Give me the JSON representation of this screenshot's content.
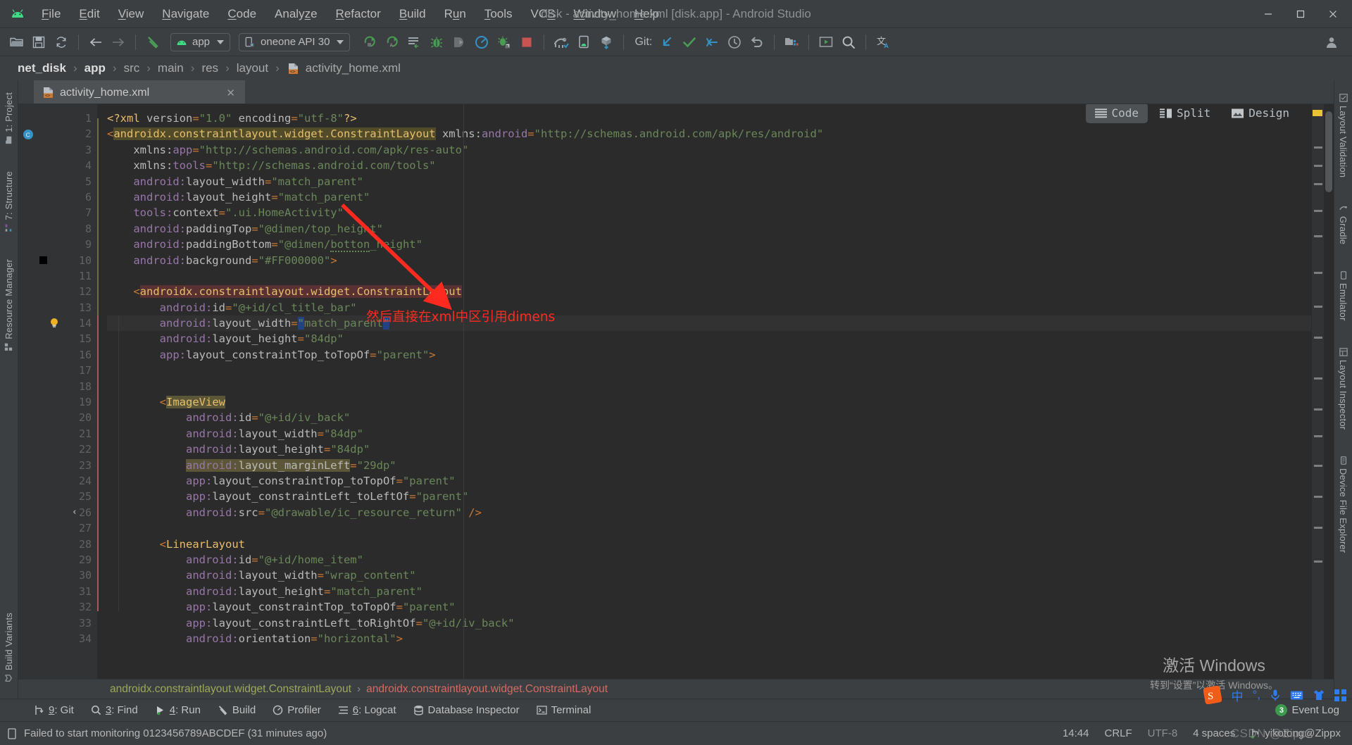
{
  "window": {
    "title": "disk - activity_home.xml [disk.app] - Android Studio",
    "minimize": "–",
    "maximize": "❐",
    "close": "✕"
  },
  "menu": {
    "items": [
      {
        "label": "File",
        "mnemonic": "F"
      },
      {
        "label": "Edit",
        "mnemonic": "E"
      },
      {
        "label": "View",
        "mnemonic": "V"
      },
      {
        "label": "Navigate",
        "mnemonic": "N"
      },
      {
        "label": "Code",
        "mnemonic": "C"
      },
      {
        "label": "Analyze",
        "mnemonic": "z"
      },
      {
        "label": "Refactor",
        "mnemonic": "R"
      },
      {
        "label": "Build",
        "mnemonic": "B"
      },
      {
        "label": "Run",
        "mnemonic": "u"
      },
      {
        "label": "Tools",
        "mnemonic": "T"
      },
      {
        "label": "VCS",
        "mnemonic": "S"
      },
      {
        "label": "Window",
        "mnemonic": "W"
      },
      {
        "label": "Help",
        "mnemonic": "H"
      }
    ]
  },
  "toolbar": {
    "open_icon": "folder-open-icon",
    "save_icon": "save-icon",
    "sync_icon": "sync-icon",
    "back_icon": "back-arrow-icon",
    "forward_icon": "forward-arrow-icon",
    "build_icon": "hammer-icon",
    "module_selector": "app",
    "device_selector": "oneone API 30",
    "run_icon": "run-icon",
    "debug_icon": "debug-icon",
    "apply_changes_icon": "apply-changes-icon",
    "stop_icon": "stop-icon",
    "git_label": "Git:",
    "update_icon": "update-project-icon",
    "commit_icon": "commit-checkmark-icon",
    "push_icon": "push-icon",
    "history_icon": "history-clock-icon",
    "undo_icon": "undo-icon",
    "sdk_manager_icon": "sdk-manager-icon",
    "avd_manager_icon": "avd-manager-icon",
    "search_icon": "search-everywhere-icon",
    "translate_icon": "translate-icon",
    "account_icon": "account-icon"
  },
  "breadcrumb": {
    "items": [
      "net_disk",
      "app",
      "src",
      "main",
      "res",
      "layout",
      "activity_home.xml"
    ],
    "separator": "›",
    "file_icon": "xml-file-icon"
  },
  "editor": {
    "tab": {
      "label": "activity_home.xml",
      "icon": "xml-file-icon",
      "close": "✕"
    },
    "view_modes": [
      {
        "label": "Code",
        "icon": "code-lines-icon",
        "active": true
      },
      {
        "label": "Split",
        "icon": "split-view-icon",
        "active": false
      },
      {
        "label": "Design",
        "icon": "design-preview-icon",
        "active": false
      }
    ],
    "code_breadcrumb": {
      "parent": "androidx.constraintlayout.widget.ConstraintLayout",
      "separator": "›",
      "current": "androidx.constraintlayout.widget.ConstraintLayout"
    },
    "lines": [
      {
        "n": 1,
        "indent": 0,
        "text": "<?xml version=\"1.0\" encoding=\"utf-8\"?>"
      },
      {
        "n": 2,
        "indent": 0,
        "text": "<androidx.constraintlayout.widget.ConstraintLayout xmlns:android=\"http://schemas.android.com/apk/res/android\""
      },
      {
        "n": 3,
        "indent": 1,
        "text": "xmlns:app=\"http://schemas.android.com/apk/res-auto\""
      },
      {
        "n": 4,
        "indent": 1,
        "text": "xmlns:tools=\"http://schemas.android.com/tools\""
      },
      {
        "n": 5,
        "indent": 1,
        "text": "android:layout_width=\"match_parent\""
      },
      {
        "n": 6,
        "indent": 1,
        "text": "android:layout_height=\"match_parent\""
      },
      {
        "n": 7,
        "indent": 1,
        "text": "tools:context=\".ui.HomeActivity\""
      },
      {
        "n": 8,
        "indent": 1,
        "text": "android:paddingTop=\"@dimen/top_height\""
      },
      {
        "n": 9,
        "indent": 1,
        "text": "android:paddingBottom=\"@dimen/botton_height\""
      },
      {
        "n": 10,
        "indent": 1,
        "text": "android:background=\"#FF000000\">"
      },
      {
        "n": 11,
        "indent": 0,
        "text": ""
      },
      {
        "n": 12,
        "indent": 1,
        "text": "<androidx.constraintlayout.widget.ConstraintLayout"
      },
      {
        "n": 13,
        "indent": 2,
        "text": "android:id=\"@+id/cl_title_bar\""
      },
      {
        "n": 14,
        "indent": 2,
        "text": "android:layout_width=\"match_parent\""
      },
      {
        "n": 15,
        "indent": 2,
        "text": "android:layout_height=\"84dp\""
      },
      {
        "n": 16,
        "indent": 2,
        "text": "app:layout_constraintTop_toTopOf=\"parent\">"
      },
      {
        "n": 17,
        "indent": 0,
        "text": ""
      },
      {
        "n": 18,
        "indent": 0,
        "text": ""
      },
      {
        "n": 19,
        "indent": 2,
        "text": "<ImageView"
      },
      {
        "n": 20,
        "indent": 3,
        "text": "android:id=\"@+id/iv_back\""
      },
      {
        "n": 21,
        "indent": 3,
        "text": "android:layout_width=\"84dp\""
      },
      {
        "n": 22,
        "indent": 3,
        "text": "android:layout_height=\"84dp\""
      },
      {
        "n": 23,
        "indent": 3,
        "text": "android:layout_marginLeft=\"29dp\""
      },
      {
        "n": 24,
        "indent": 3,
        "text": "app:layout_constraintTop_toTopOf=\"parent\""
      },
      {
        "n": 25,
        "indent": 3,
        "text": "app:layout_constraintLeft_toLeftOf=\"parent\""
      },
      {
        "n": 26,
        "indent": 3,
        "text": "android:src=\"@drawable/ic_resource_return\" />"
      },
      {
        "n": 27,
        "indent": 0,
        "text": ""
      },
      {
        "n": 28,
        "indent": 2,
        "text": "<LinearLayout"
      },
      {
        "n": 29,
        "indent": 3,
        "text": "android:id=\"@+id/home_item\""
      },
      {
        "n": 30,
        "indent": 3,
        "text": "android:layout_width=\"wrap_content\""
      },
      {
        "n": 31,
        "indent": 3,
        "text": "android:layout_height=\"match_parent\""
      },
      {
        "n": 32,
        "indent": 3,
        "text": "app:layout_constraintTop_toTopOf=\"parent\""
      },
      {
        "n": 33,
        "indent": 3,
        "text": "app:layout_constraintLeft_toRightOf=\"@+id/iv_back\""
      },
      {
        "n": 34,
        "indent": 3,
        "text": "android:orientation=\"horizontal\">"
      }
    ],
    "gutter_marks": {
      "line2_icon": "class-marker-c",
      "line10_icon": "color-swatch-black",
      "line14_icon": "intention-bulb-icon",
      "line26_icon": "collapse-chevron-icon"
    }
  },
  "annotation": {
    "text": "然后直接在xml中区引用dimens",
    "color": "#ff2a1f"
  },
  "left_rail": {
    "items": [
      {
        "label": "1: Project",
        "num": "1",
        "icon": "project-icon"
      },
      {
        "label": "7: Structure",
        "num": "7",
        "icon": "structure-icon"
      },
      {
        "label": "Resource Manager",
        "num": "",
        "icon": "resource-manager-icon"
      },
      {
        "label": "Build Variants",
        "num": "",
        "icon": "build-variants-icon"
      }
    ]
  },
  "right_rail": {
    "items": [
      {
        "label": "Layout Validation",
        "icon": "layout-validation-icon"
      },
      {
        "label": "Gradle",
        "icon": "gradle-icon"
      },
      {
        "label": "Emulator",
        "icon": "emulator-icon"
      },
      {
        "label": "Layout Inspector",
        "icon": "layout-inspector-icon"
      },
      {
        "label": "Device File Explorer",
        "icon": "device-file-explorer-icon"
      }
    ]
  },
  "tool_windows": {
    "items": [
      {
        "label": "9: Git",
        "num": "9",
        "name": "Git",
        "icon": "git-icon"
      },
      {
        "label": "3: Find",
        "num": "3",
        "name": "Find",
        "icon": "search-icon"
      },
      {
        "label": "4: Run",
        "num": "4",
        "name": "Run",
        "icon": "run-triangle-icon"
      },
      {
        "label": "Build",
        "num": "",
        "name": "Build",
        "icon": "hammer-icon"
      },
      {
        "label": "Profiler",
        "num": "",
        "name": "Profiler",
        "icon": "profiler-gauge-icon"
      },
      {
        "label": "6: Logcat",
        "num": "6",
        "name": "Logcat",
        "icon": "logcat-icon"
      },
      {
        "label": "Database Inspector",
        "num": "",
        "name": "Database Inspector",
        "icon": "database-icon"
      },
      {
        "label": "Terminal",
        "num": "",
        "name": "Terminal",
        "icon": "terminal-icon"
      }
    ],
    "event_log": {
      "label": "Event Log",
      "badge": "3",
      "icon": "event-log-icon"
    }
  },
  "status_bar": {
    "message": "Failed to start monitoring 0123456789ABCDEF (31 minutes ago)",
    "message_icon": "device-icon",
    "time": "14:44",
    "line_separator": "CRLF",
    "encoding": "UTF-8",
    "indent": "4 spaces",
    "branch": "yikotong@Zippx",
    "branch_icon": "git-branch-icon"
  },
  "watermark": {
    "line1": "激活 Windows",
    "line2": "转到“设置”以激活 Windows。",
    "csdn": "CSDN @Zippx"
  },
  "tray": {
    "ime": "中",
    "icons": [
      "sogou-icon",
      "ime-mode-icon",
      "microphone-icon",
      "keyboard-icon",
      "skin-icon",
      "apps-grid-icon"
    ]
  },
  "colors": {
    "accent_green": "#4fa84f",
    "annotation_red": "#ff2a1f",
    "tag_yellow": "#e8bf6a",
    "string_green": "#6a8759",
    "attr_purple": "#9876aa",
    "editor_bg": "#2b2b2b",
    "chrome_bg": "#3c3f41"
  }
}
